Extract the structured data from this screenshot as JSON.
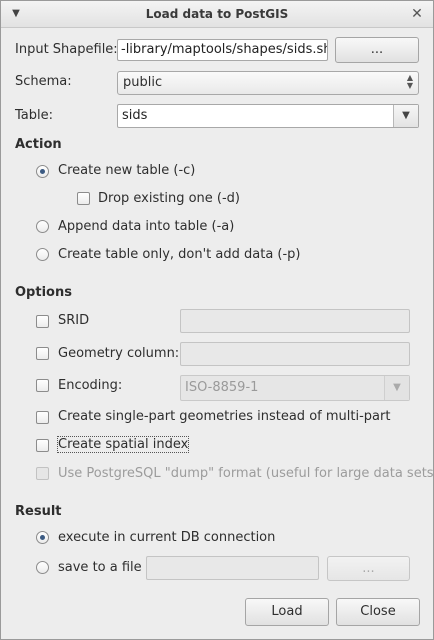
{
  "window": {
    "title": "Load data to PostGIS",
    "menu_icon": "chevron-down-icon",
    "close_icon": "close-icon"
  },
  "input": {
    "shapefile_label": "Input Shapefile:",
    "shapefile_value": "-library/maptools/shapes/sids.shp",
    "browse_label": "...",
    "schema_label": "Schema:",
    "schema_value": "public",
    "table_label": "Table:",
    "table_value": "sids"
  },
  "action": {
    "heading": "Action",
    "options": [
      {
        "label": "Create new table (-c)",
        "checked": true
      },
      {
        "label": "Drop existing one (-d)",
        "checked": false
      },
      {
        "label": "Append data into table (-a)",
        "checked": false
      },
      {
        "label": "Create table only, don't add data (-p)",
        "checked": false
      }
    ]
  },
  "options": {
    "heading": "Options",
    "srid_label": "SRID",
    "srid_value": "",
    "geometry_label": "Geometry column:",
    "geometry_value": "",
    "encoding_label": "Encoding:",
    "encoding_value": "ISO-8859-1",
    "singlepart_label": "Create single-part geometries instead of multi-part",
    "spatial_index_label": "Create spatial index",
    "dump_label": "Use PostgreSQL \"dump\" format (useful for large data sets)"
  },
  "result": {
    "heading": "Result",
    "execute_label": "execute in current DB connection",
    "save_label": "save to a file",
    "file_value": "",
    "browse_label": "..."
  },
  "footer": {
    "load_label": "Load",
    "close_label": "Close"
  },
  "colors": {
    "background": "#ededed",
    "radio_dot": "#3b5a82"
  }
}
